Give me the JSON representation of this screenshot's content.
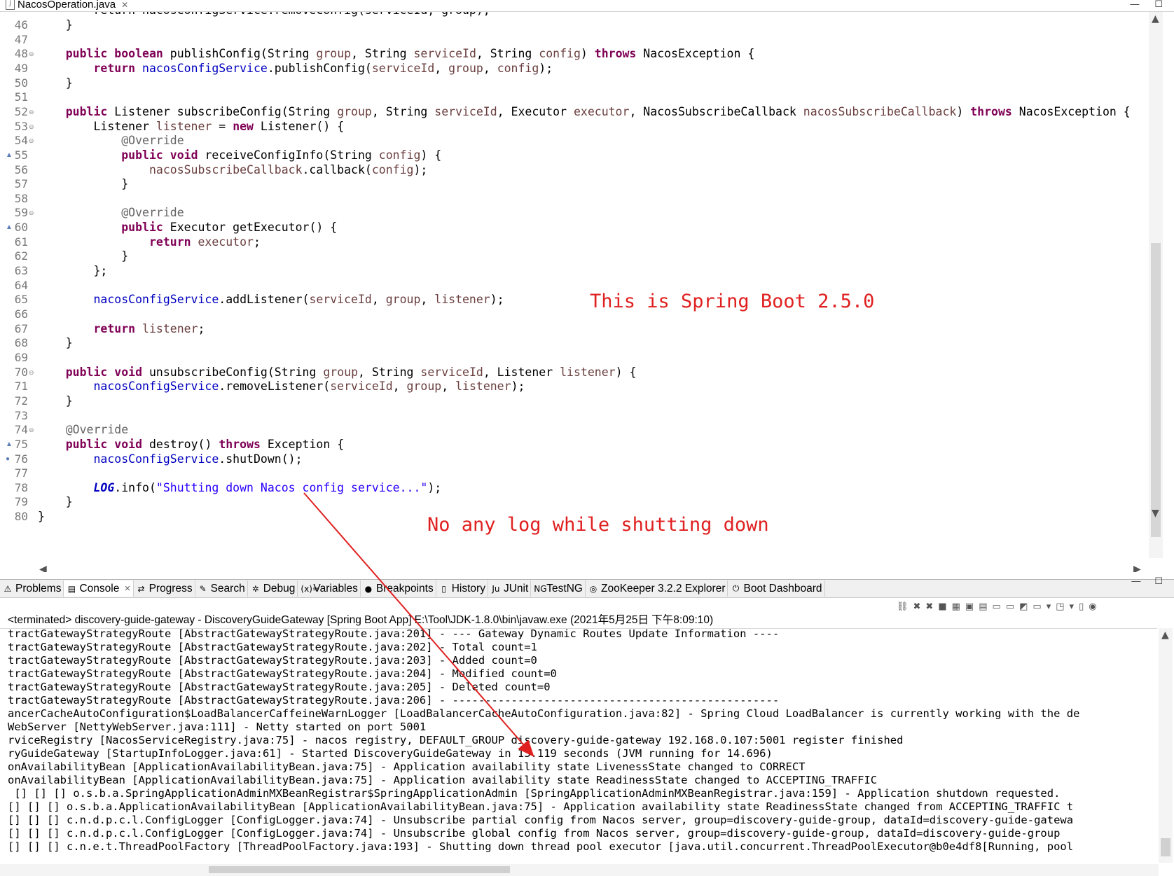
{
  "editor": {
    "tab_label": "NacosOperation.java",
    "first_line_partial": "        return nacosConfigService.removeConfig(serviceId, group);",
    "lines": [
      {
        "n": "46",
        "mark": "",
        "tokens": [
          {
            "t": "    }",
            "c": ""
          }
        ]
      },
      {
        "n": "47",
        "mark": "",
        "tokens": []
      },
      {
        "n": "48",
        "mark": "fold",
        "tokens": [
          {
            "t": "    ",
            "c": ""
          },
          {
            "t": "public",
            "c": "kw"
          },
          {
            "t": " ",
            "c": ""
          },
          {
            "t": "boolean",
            "c": "kw"
          },
          {
            "t": " publishConfig(String ",
            "c": ""
          },
          {
            "t": "group",
            "c": "var"
          },
          {
            "t": ", String ",
            "c": ""
          },
          {
            "t": "serviceId",
            "c": "var"
          },
          {
            "t": ", String ",
            "c": ""
          },
          {
            "t": "config",
            "c": "var"
          },
          {
            "t": ") ",
            "c": ""
          },
          {
            "t": "throws",
            "c": "kw"
          },
          {
            "t": " NacosException {",
            "c": ""
          }
        ]
      },
      {
        "n": "49",
        "mark": "",
        "tokens": [
          {
            "t": "        ",
            "c": ""
          },
          {
            "t": "return",
            "c": "kw"
          },
          {
            "t": " ",
            "c": ""
          },
          {
            "t": "nacosConfigService",
            "c": "fld"
          },
          {
            "t": ".publishConfig(",
            "c": ""
          },
          {
            "t": "serviceId",
            "c": "var"
          },
          {
            "t": ", ",
            "c": ""
          },
          {
            "t": "group",
            "c": "var"
          },
          {
            "t": ", ",
            "c": ""
          },
          {
            "t": "config",
            "c": "var"
          },
          {
            "t": ");",
            "c": ""
          }
        ]
      },
      {
        "n": "50",
        "mark": "",
        "tokens": [
          {
            "t": "    }",
            "c": ""
          }
        ]
      },
      {
        "n": "51",
        "mark": "",
        "tokens": []
      },
      {
        "n": "52",
        "mark": "fold",
        "tokens": [
          {
            "t": "    ",
            "c": ""
          },
          {
            "t": "public",
            "c": "kw"
          },
          {
            "t": " Listener subscribeConfig(String ",
            "c": ""
          },
          {
            "t": "group",
            "c": "var"
          },
          {
            "t": ", String ",
            "c": ""
          },
          {
            "t": "serviceId",
            "c": "var"
          },
          {
            "t": ", Executor ",
            "c": ""
          },
          {
            "t": "executor",
            "c": "var"
          },
          {
            "t": ", NacosSubscribeCallback ",
            "c": ""
          },
          {
            "t": "nacosSubscribeCallback",
            "c": "var"
          },
          {
            "t": ") ",
            "c": ""
          },
          {
            "t": "throws",
            "c": "kw"
          },
          {
            "t": " NacosException {",
            "c": ""
          }
        ]
      },
      {
        "n": "53",
        "mark": "fold",
        "tokens": [
          {
            "t": "        Listener ",
            "c": ""
          },
          {
            "t": "listener",
            "c": "var"
          },
          {
            "t": " = ",
            "c": ""
          },
          {
            "t": "new",
            "c": "kw"
          },
          {
            "t": " Listener() {",
            "c": ""
          }
        ]
      },
      {
        "n": "54",
        "mark": "fold",
        "tokens": [
          {
            "t": "            ",
            "c": ""
          },
          {
            "t": "@Override",
            "c": "ann"
          }
        ]
      },
      {
        "n": "55",
        "mark": "override",
        "tokens": [
          {
            "t": "            ",
            "c": ""
          },
          {
            "t": "public",
            "c": "kw"
          },
          {
            "t": " ",
            "c": ""
          },
          {
            "t": "void",
            "c": "kw"
          },
          {
            "t": " receiveConfigInfo(String ",
            "c": ""
          },
          {
            "t": "config",
            "c": "var"
          },
          {
            "t": ") {",
            "c": ""
          }
        ]
      },
      {
        "n": "56",
        "mark": "",
        "tokens": [
          {
            "t": "                ",
            "c": ""
          },
          {
            "t": "nacosSubscribeCallback",
            "c": "var"
          },
          {
            "t": ".callback(",
            "c": ""
          },
          {
            "t": "config",
            "c": "var"
          },
          {
            "t": ");",
            "c": ""
          }
        ]
      },
      {
        "n": "57",
        "mark": "",
        "tokens": [
          {
            "t": "            }",
            "c": ""
          }
        ]
      },
      {
        "n": "58",
        "mark": "",
        "tokens": []
      },
      {
        "n": "59",
        "mark": "fold",
        "tokens": [
          {
            "t": "            ",
            "c": ""
          },
          {
            "t": "@Override",
            "c": "ann"
          }
        ]
      },
      {
        "n": "60",
        "mark": "override",
        "tokens": [
          {
            "t": "            ",
            "c": ""
          },
          {
            "t": "public",
            "c": "kw"
          },
          {
            "t": " Executor getExecutor() {",
            "c": ""
          }
        ]
      },
      {
        "n": "61",
        "mark": "",
        "tokens": [
          {
            "t": "                ",
            "c": ""
          },
          {
            "t": "return",
            "c": "kw"
          },
          {
            "t": " ",
            "c": ""
          },
          {
            "t": "executor",
            "c": "var"
          },
          {
            "t": ";",
            "c": ""
          }
        ]
      },
      {
        "n": "62",
        "mark": "",
        "tokens": [
          {
            "t": "            }",
            "c": ""
          }
        ]
      },
      {
        "n": "63",
        "mark": "",
        "tokens": [
          {
            "t": "        };",
            "c": ""
          }
        ]
      },
      {
        "n": "64",
        "mark": "",
        "tokens": []
      },
      {
        "n": "65",
        "mark": "",
        "tokens": [
          {
            "t": "        ",
            "c": ""
          },
          {
            "t": "nacosConfigService",
            "c": "fld"
          },
          {
            "t": ".addListener(",
            "c": ""
          },
          {
            "t": "serviceId",
            "c": "var"
          },
          {
            "t": ", ",
            "c": ""
          },
          {
            "t": "group",
            "c": "var"
          },
          {
            "t": ", ",
            "c": ""
          },
          {
            "t": "listener",
            "c": "var"
          },
          {
            "t": ");",
            "c": ""
          }
        ]
      },
      {
        "n": "66",
        "mark": "",
        "tokens": []
      },
      {
        "n": "67",
        "mark": "",
        "tokens": [
          {
            "t": "        ",
            "c": ""
          },
          {
            "t": "return",
            "c": "kw"
          },
          {
            "t": " ",
            "c": ""
          },
          {
            "t": "listener",
            "c": "var"
          },
          {
            "t": ";",
            "c": ""
          }
        ]
      },
      {
        "n": "68",
        "mark": "",
        "tokens": [
          {
            "t": "    }",
            "c": ""
          }
        ]
      },
      {
        "n": "69",
        "mark": "",
        "tokens": []
      },
      {
        "n": "70",
        "mark": "fold",
        "tokens": [
          {
            "t": "    ",
            "c": ""
          },
          {
            "t": "public",
            "c": "kw"
          },
          {
            "t": " ",
            "c": ""
          },
          {
            "t": "void",
            "c": "kw"
          },
          {
            "t": " unsubscribeConfig(String ",
            "c": ""
          },
          {
            "t": "group",
            "c": "var"
          },
          {
            "t": ", String ",
            "c": ""
          },
          {
            "t": "serviceId",
            "c": "var"
          },
          {
            "t": ", Listener ",
            "c": ""
          },
          {
            "t": "listener",
            "c": "var"
          },
          {
            "t": ") {",
            "c": ""
          }
        ]
      },
      {
        "n": "71",
        "mark": "",
        "tokens": [
          {
            "t": "        ",
            "c": ""
          },
          {
            "t": "nacosConfigService",
            "c": "fld"
          },
          {
            "t": ".removeListener(",
            "c": ""
          },
          {
            "t": "serviceId",
            "c": "var"
          },
          {
            "t": ", ",
            "c": ""
          },
          {
            "t": "group",
            "c": "var"
          },
          {
            "t": ", ",
            "c": ""
          },
          {
            "t": "listener",
            "c": "var"
          },
          {
            "t": ");",
            "c": ""
          }
        ]
      },
      {
        "n": "72",
        "mark": "",
        "tokens": [
          {
            "t": "    }",
            "c": ""
          }
        ]
      },
      {
        "n": "73",
        "mark": "",
        "tokens": []
      },
      {
        "n": "74",
        "mark": "fold",
        "tokens": [
          {
            "t": "    ",
            "c": ""
          },
          {
            "t": "@Override",
            "c": "ann"
          }
        ]
      },
      {
        "n": "75",
        "mark": "override",
        "tokens": [
          {
            "t": "    ",
            "c": ""
          },
          {
            "t": "public",
            "c": "kw"
          },
          {
            "t": " ",
            "c": ""
          },
          {
            "t": "void",
            "c": "kw"
          },
          {
            "t": " destroy() ",
            "c": ""
          },
          {
            "t": "throws",
            "c": "kw"
          },
          {
            "t": " Exception {",
            "c": ""
          }
        ]
      },
      {
        "n": "76",
        "mark": "dot",
        "tokens": [
          {
            "t": "        ",
            "c": ""
          },
          {
            "t": "nacosConfigService",
            "c": "fld"
          },
          {
            "t": ".shutDown();",
            "c": ""
          }
        ]
      },
      {
        "n": "77",
        "mark": "",
        "tokens": []
      },
      {
        "n": "78",
        "mark": "",
        "tokens": [
          {
            "t": "        ",
            "c": ""
          },
          {
            "t": "LOG",
            "c": "static-fld"
          },
          {
            "t": ".info(",
            "c": ""
          },
          {
            "t": "\"Shutting down Nacos config service...\"",
            "c": "str"
          },
          {
            "t": ");",
            "c": ""
          }
        ]
      },
      {
        "n": "79",
        "mark": "",
        "tokens": [
          {
            "t": "    }",
            "c": ""
          }
        ]
      },
      {
        "n": "80",
        "mark": "",
        "tokens": [
          {
            "t": "}",
            "c": ""
          }
        ]
      }
    ]
  },
  "annotations": {
    "spring_boot_note": "This is Spring Boot 2.5.0",
    "no_log_note": "No any log while shutting down",
    "color": "#e02020"
  },
  "views": {
    "tabs": [
      {
        "label": "Problems",
        "icon": "problems-icon",
        "glyph": "⚠",
        "active": false
      },
      {
        "label": "Console",
        "icon": "console-icon",
        "glyph": "▤",
        "active": true
      },
      {
        "label": "Progress",
        "icon": "progress-icon",
        "glyph": "⇄",
        "active": false
      },
      {
        "label": "Search",
        "icon": "search-icon",
        "glyph": "✎",
        "active": false
      },
      {
        "label": "Debug",
        "icon": "debug-icon",
        "glyph": "✲",
        "active": false
      },
      {
        "label": "Variables",
        "icon": "variables-icon",
        "glyph": "(x)=",
        "active": false
      },
      {
        "label": "Breakpoints",
        "icon": "breakpoints-icon",
        "glyph": "●",
        "active": false
      },
      {
        "label": "History",
        "icon": "history-icon",
        "glyph": "▯",
        "active": false
      },
      {
        "label": "JUnit",
        "icon": "junit-icon",
        "glyph": "Ju",
        "active": false
      },
      {
        "label": "TestNG",
        "icon": "testng-icon",
        "glyph": "NG",
        "active": false
      },
      {
        "label": "ZooKeeper 3.2.2 Explorer",
        "icon": "zookeeper-icon",
        "glyph": "◎",
        "active": false
      },
      {
        "label": "Boot Dashboard",
        "icon": "boot-dashboard-icon",
        "glyph": "⏻",
        "active": false
      }
    ]
  },
  "console": {
    "title": "<terminated> discovery-guide-gateway - DiscoveryGuideGateway [Spring Boot App] E:\\Tool\\JDK-1.8.0\\bin\\javaw.exe (2021年5月25日 下午8:09:10)",
    "lines": [
      "tractGatewayStrategyRoute [AbstractGatewayStrategyRoute.java:201] - --- Gateway Dynamic Routes Update Information ----",
      "tractGatewayStrategyRoute [AbstractGatewayStrategyRoute.java:202] - Total count=1",
      "tractGatewayStrategyRoute [AbstractGatewayStrategyRoute.java:203] - Added count=0",
      "tractGatewayStrategyRoute [AbstractGatewayStrategyRoute.java:204] - Modified count=0",
      "tractGatewayStrategyRoute [AbstractGatewayStrategyRoute.java:205] - Deleted count=0",
      "tractGatewayStrategyRoute [AbstractGatewayStrategyRoute.java:206] - --------------------------------------------------",
      "ancerCacheAutoConfiguration$LoadBalancerCaffeineWarnLogger [LoadBalancerCacheAutoConfiguration.java:82] - Spring Cloud LoadBalancer is currently working with the de",
      "WebServer [NettyWebServer.java:111] - Netty started on port 5001",
      "rviceRegistry [NacosServiceRegistry.java:75] - nacos registry, DEFAULT_GROUP discovery-guide-gateway 192.168.0.107:5001 register finished",
      "ryGuideGateway [StartupInfoLogger.java:61] - Started DiscoveryGuideGateway in 13.119 seconds (JVM running for 14.696)",
      "onAvailabilityBean [ApplicationAvailabilityBean.java:75] - Application availability state LivenessState changed to CORRECT",
      "onAvailabilityBean [ApplicationAvailabilityBean.java:75] - Application availability state ReadinessState changed to ACCEPTING_TRAFFIC",
      " [] [] [] o.s.b.a.SpringApplicationAdminMXBeanRegistrar$SpringApplicationAdmin [SpringApplicationAdminMXBeanRegistrar.java:159] - Application shutdown requested.",
      "[] [] [] o.s.b.a.ApplicationAvailabilityBean [ApplicationAvailabilityBean.java:75] - Application availability state ReadinessState changed from ACCEPTING_TRAFFIC t",
      "[] [] [] c.n.d.p.c.l.ConfigLogger [ConfigLogger.java:74] - Unsubscribe partial config from Nacos server, group=discovery-guide-group, dataId=discovery-guide-gatewa",
      "[] [] [] c.n.d.p.c.l.ConfigLogger [ConfigLogger.java:74] - Unsubscribe global config from Nacos server, group=discovery-guide-group, dataId=discovery-guide-group",
      "[] [] [] c.n.e.t.ThreadPoolFactory [ThreadPoolFactory.java:193] - Shutting down thread pool executor [java.util.concurrent.ThreadPoolExecutor@b0e4df8[Running, pool"
    ]
  },
  "toolbar_icons": [
    {
      "name": "link-icon",
      "glyph": "⛓"
    },
    {
      "name": "remove-launch-icon",
      "glyph": "✖"
    },
    {
      "name": "remove-all-icon",
      "glyph": "✖"
    },
    {
      "name": "stop-icon",
      "glyph": "■"
    },
    {
      "name": "clear-console-icon",
      "glyph": "▦"
    },
    {
      "name": "scroll-lock-icon",
      "glyph": "▣"
    },
    {
      "name": "word-wrap-icon",
      "glyph": "▤"
    },
    {
      "name": "show-stdout-icon",
      "glyph": "▭"
    },
    {
      "name": "show-stderr-icon",
      "glyph": "▭"
    },
    {
      "name": "pin-console-icon",
      "glyph": "◩"
    },
    {
      "name": "display-console-icon",
      "glyph": "▭"
    },
    {
      "name": "display-dropdown-icon",
      "glyph": "▾"
    },
    {
      "name": "open-console-icon",
      "glyph": "◳"
    },
    {
      "name": "open-dropdown-icon",
      "glyph": "▾"
    },
    {
      "name": "minimize-icon",
      "glyph": "▯"
    },
    {
      "name": "maximize-icon",
      "glyph": "◉"
    }
  ]
}
